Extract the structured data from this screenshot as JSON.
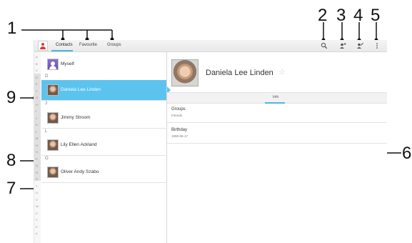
{
  "callouts": [
    "1",
    "2",
    "3",
    "4",
    "5",
    "6",
    "7",
    "8",
    "9"
  ],
  "toolbar": {
    "tabs": [
      {
        "label": "Contacts"
      },
      {
        "label": "Favourite"
      },
      {
        "label": "Groups"
      }
    ],
    "icons": [
      "search-icon",
      "add-contact-icon",
      "edit-contact-icon",
      "overflow-menu-icon"
    ]
  },
  "alpha_index": [
    "A",
    "B",
    "C",
    "D",
    "E",
    "F",
    "G",
    "H",
    "I",
    "J",
    "K",
    "L",
    "M",
    "N",
    "O",
    "P",
    "Q",
    "R",
    "S",
    "T",
    "U",
    "V",
    "W",
    "X",
    "Y",
    "Z",
    "#"
  ],
  "contacts": {
    "myself": "Myself",
    "section_d": "D",
    "daniela": "Daniela Lee Linden",
    "section_j": "J",
    "jimmy": "Jimmy Stroom",
    "section_l": "L",
    "lily": "Lily Ellen Ackland",
    "section_o": "O",
    "oliver": "Oliver Andy Szabo"
  },
  "detail": {
    "name": "Daniela Lee Linden",
    "info_tab": "Info",
    "groups_label": "Groups",
    "groups_value": "Friends",
    "birthday_label": "Birthday",
    "birthday_value": "1990-06-17"
  },
  "colors": {
    "selected_row": "#5cc3ef",
    "accent": "#4fb3e6"
  }
}
